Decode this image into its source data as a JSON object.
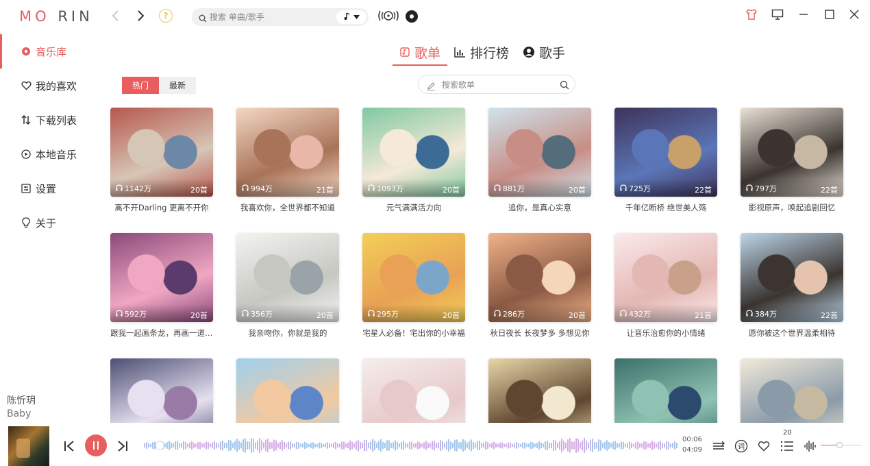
{
  "app": {
    "logo_left": "MO",
    "logo_right": "RIN",
    "help_glyph": "?"
  },
  "search": {
    "placeholder": "搜索 单曲/歌手"
  },
  "sidebar": {
    "items": [
      {
        "label": "音乐库",
        "icon": "music-library-icon",
        "active": true
      },
      {
        "label": "我的喜欢",
        "icon": "heart-icon",
        "active": false
      },
      {
        "label": "下载列表",
        "icon": "download-sort-icon",
        "active": false
      },
      {
        "label": "本地音乐",
        "icon": "play-circle-icon",
        "active": false
      },
      {
        "label": "设置",
        "icon": "settings-icon",
        "active": false
      },
      {
        "label": "关于",
        "icon": "bulb-icon",
        "active": false
      }
    ]
  },
  "tabs": [
    {
      "label": "歌单",
      "icon": "playlist-icon",
      "active": true
    },
    {
      "label": "排行榜",
      "icon": "chart-icon",
      "active": false
    },
    {
      "label": "歌手",
      "icon": "singer-icon",
      "active": false
    }
  ],
  "filter": {
    "hot": "热门",
    "new": "最新"
  },
  "playlist_search": {
    "placeholder": "搜索歌单"
  },
  "accent": "#e85d5d",
  "playlists": [
    {
      "plays": "1142万",
      "count": "20首",
      "title": "离不开Darling 更离不开你",
      "c1": "#b7574d",
      "c2": "#d6c6b6",
      "c3": "#6d87a8"
    },
    {
      "plays": "994万",
      "count": "21首",
      "title": "我喜欢你，全世界都不知道",
      "c1": "#f4d7c3",
      "c2": "#a87358",
      "c3": "#e8b7a8"
    },
    {
      "plays": "1093万",
      "count": "20首",
      "title": "元气满满活力向",
      "c1": "#7fc9a1",
      "c2": "#f5e9d8",
      "c3": "#3c6b95"
    },
    {
      "plays": "881万",
      "count": "20首",
      "title": "追你，是真心实意",
      "c1": "#cfe3ec",
      "c2": "#c88d85",
      "c3": "#556d7a"
    },
    {
      "plays": "725万",
      "count": "22首",
      "title": "千年亿断桥 绝世美人殇",
      "c1": "#3e3359",
      "c2": "#5b76b8",
      "c3": "#c8a06a"
    },
    {
      "plays": "797万",
      "count": "22首",
      "title": "影视原声，唤起追剧回忆",
      "c1": "#e9e1d5",
      "c2": "#3a3330",
      "c3": "#c7b8a4"
    },
    {
      "plays": "592万",
      "count": "20首",
      "title": "跟我一起画条龙，再画一道彩虹",
      "c1": "#8a4a7a",
      "c2": "#f0a7c2",
      "c3": "#5b3b6b"
    },
    {
      "plays": "356万",
      "count": "20首",
      "title": "我亲吻你，你就是我的",
      "c1": "#f3f3f0",
      "c2": "#c7c7c2",
      "c3": "#9aa3a8"
    },
    {
      "plays": "295万",
      "count": "20首",
      "title": "宅星人必备！宅出你的小幸福",
      "c1": "#f3cf57",
      "c2": "#e8a155",
      "c3": "#7ba6c9"
    },
    {
      "plays": "286万",
      "count": "20首",
      "title": "秋日夜长 长夜梦多 多想见你",
      "c1": "#f0b289",
      "c2": "#8b5a44",
      "c3": "#f6d6b8"
    },
    {
      "plays": "432万",
      "count": "21首",
      "title": "让音乐治愈你的小情绪",
      "c1": "#fbeaea",
      "c2": "#e3b7b4",
      "c3": "#c9a18a"
    },
    {
      "plays": "384万",
      "count": "22首",
      "title": "愿你被这个世界温柔相待",
      "c1": "#bcd6ea",
      "c2": "#3b3430",
      "c3": "#e5c3ac"
    },
    {
      "plays": "",
      "count": "",
      "title": "",
      "c1": "#4d4f74",
      "c2": "#e6e0f0",
      "c3": "#9a7ba8"
    },
    {
      "plays": "",
      "count": "",
      "title": "",
      "c1": "#9ed0ef",
      "c2": "#f2c9a0",
      "c3": "#5d86c9"
    },
    {
      "plays": "",
      "count": "",
      "title": "",
      "c1": "#f5eded",
      "c2": "#e7c9c9",
      "c3": "#fafafa"
    },
    {
      "plays": "",
      "count": "",
      "title": "",
      "c1": "#e8d7a8",
      "c2": "#5e4630",
      "c3": "#f1e8cf"
    },
    {
      "plays": "",
      "count": "",
      "title": "",
      "c1": "#3b6f6a",
      "c2": "#8fc2b2",
      "c3": "#2c4a6e"
    },
    {
      "plays": "",
      "count": "",
      "title": "",
      "c1": "#f1ead9",
      "c2": "#8a9aa8",
      "c3": "#c6b9a2"
    }
  ],
  "player": {
    "song_title": "陈忻玥",
    "artist": "Baby",
    "current_time": "00:06",
    "total_time": "04:09",
    "queue_count": "20",
    "progress": 0.03,
    "volume": 0.45,
    "playing": true
  }
}
